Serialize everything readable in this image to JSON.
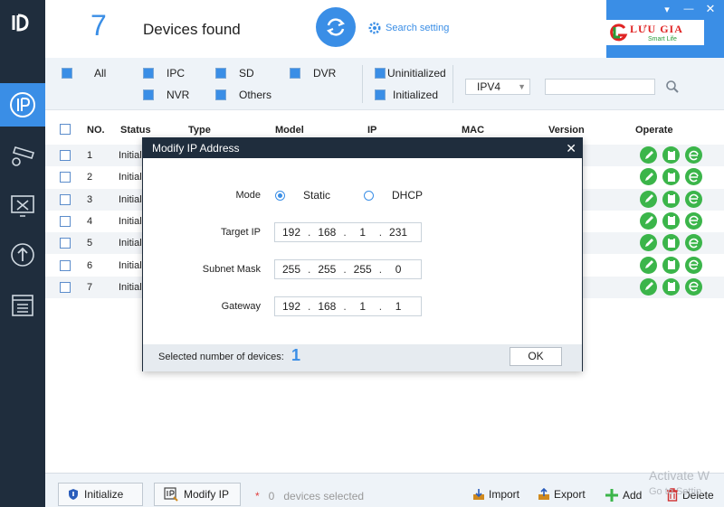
{
  "header": {
    "device_count": "7",
    "devices_found_label": "Devices found",
    "search_setting_label": "Search setting",
    "brand_name": "LƯU GIA",
    "brand_tagline": "Smart Life"
  },
  "filters": {
    "all": "All",
    "ipc": "IPC",
    "sd": "SD",
    "dvr": "DVR",
    "nvr": "NVR",
    "others": "Others",
    "uninitialized": "Uninitialized",
    "initialized": "Initialized",
    "ip_version": "IPV4",
    "search_placeholder": ""
  },
  "table": {
    "columns": [
      "NO.",
      "Status",
      "Type",
      "Model",
      "IP",
      "MAC",
      "Version",
      "Operate"
    ],
    "rows": [
      {
        "no": "1",
        "status": "Initial"
      },
      {
        "no": "2",
        "status": "Initial"
      },
      {
        "no": "3",
        "status": "Initial"
      },
      {
        "no": "4",
        "status": "Initial"
      },
      {
        "no": "5",
        "status": "Initial"
      },
      {
        "no": "6",
        "status": "Initial"
      },
      {
        "no": "7",
        "status": "Initial"
      }
    ]
  },
  "modal": {
    "title": "Modify IP Address",
    "mode_label": "Mode",
    "static_label": "Static",
    "dhcp_label": "DHCP",
    "mode_selected": "Static",
    "target_ip_label": "Target IP",
    "target_ip": [
      "192",
      "168",
      "1",
      "231"
    ],
    "subnet_label": "Subnet Mask",
    "subnet": [
      "255",
      "255",
      "255",
      "0"
    ],
    "gateway_label": "Gateway",
    "gateway": [
      "192",
      "168",
      "1",
      "1"
    ],
    "selected_label": "Selected number of devices:",
    "selected_count": "1",
    "ok_label": "OK"
  },
  "bottom": {
    "initialize_label": "Initialize",
    "modify_ip_label": "Modify IP",
    "star": "*",
    "selected_count": "0",
    "selected_text": "devices selected",
    "import_label": "Import",
    "export_label": "Export",
    "add_label": "Add",
    "delete_label": "Delete"
  },
  "watermark": {
    "line1": "Activate W",
    "line2": "Go to Settin"
  },
  "colors": {
    "accent": "#3a8ee6",
    "sidebar": "#1f2d3d",
    "op_green": "#3bb54a"
  }
}
